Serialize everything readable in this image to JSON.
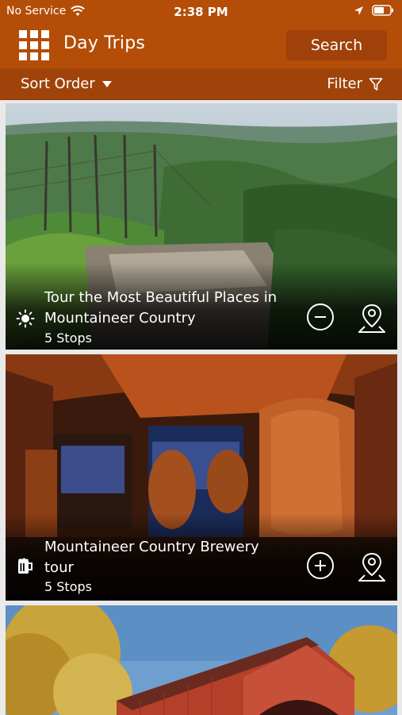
{
  "status_bar": {
    "carrier": "No Service",
    "time": "2:38 PM"
  },
  "header": {
    "title": "Day Trips",
    "search_label": "Search"
  },
  "filter_bar": {
    "sort_label": "Sort Order",
    "filter_label": "Filter"
  },
  "trips": [
    {
      "title": "Tour the Most Beautiful Places in Mountaineer Country",
      "stops": "5 Stops",
      "category_icon": "sun-icon",
      "action_icon": "minus-circle-icon"
    },
    {
      "title": "Mountaineer Country Brewery tour",
      "stops": "5 Stops",
      "category_icon": "beer-mug-icon",
      "action_icon": "plus-circle-icon"
    },
    {
      "title": "",
      "stops": "",
      "category_icon": "",
      "action_icon": ""
    }
  ],
  "colors": {
    "brand": "#b44d07",
    "filter_bar": "#a0430a",
    "search_button": "#a0400a"
  }
}
